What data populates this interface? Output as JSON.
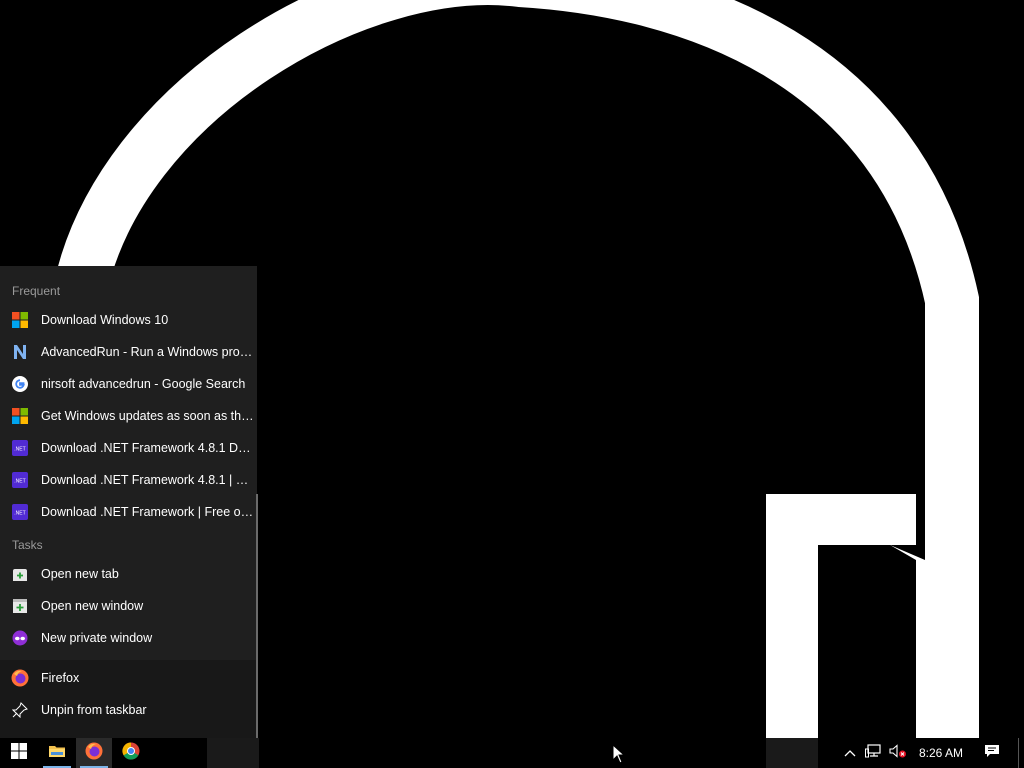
{
  "jumplist": {
    "frequent_header": "Frequent",
    "frequent": [
      {
        "label": "Download Windows 10",
        "icon": "windows-logo-icon"
      },
      {
        "label": "AdvancedRun - Run a Windows progr...",
        "icon": "nirsoft-icon"
      },
      {
        "label": "nirsoft advancedrun - Google Search",
        "icon": "google-icon"
      },
      {
        "label": "Get Windows updates as soon as they'...",
        "icon": "windows-logo-icon"
      },
      {
        "label": "Download .NET Framework 4.8.1 Devel...",
        "icon": "dotnet-icon"
      },
      {
        "label": "Download .NET Framework 4.8.1 | Free...",
        "icon": "dotnet-icon"
      },
      {
        "label": "Download .NET Framework | Free offici...",
        "icon": "dotnet-icon"
      }
    ],
    "tasks_header": "Tasks",
    "tasks": [
      {
        "label": "Open new tab",
        "icon": "new-tab-icon"
      },
      {
        "label": "Open new window",
        "icon": "new-window-icon"
      },
      {
        "label": "New private window",
        "icon": "private-window-icon"
      }
    ],
    "pinned": [
      {
        "label": "Firefox",
        "icon": "firefox-icon"
      },
      {
        "label": "Unpin from taskbar",
        "icon": "unpin-icon"
      }
    ]
  },
  "taskbar": {
    "clock": "8:26 AM",
    "apps": [
      "start-icon",
      "file-explorer-icon",
      "firefox-icon",
      "chrome-icon"
    ],
    "tray": [
      "show-hidden-icons-chevron",
      "network-icon",
      "volume-muted-icon",
      "notifications-icon"
    ]
  },
  "colors": {
    "jumplist_bg": "#1f1f1f",
    "pinned_bg": "#181818",
    "taskbar_bg": "#000000",
    "active_indicator": "#7cb4e8",
    "dotnet_purple": "#512bd4"
  }
}
